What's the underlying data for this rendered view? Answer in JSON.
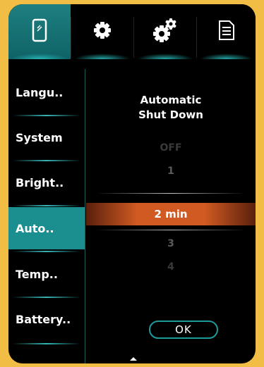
{
  "tabs": [
    {
      "icon": "phone-device-icon",
      "active": true
    },
    {
      "icon": "gear-icon",
      "active": false
    },
    {
      "icon": "gears-icon",
      "active": false
    },
    {
      "icon": "document-icon",
      "active": false
    }
  ],
  "menu": {
    "items": [
      {
        "label": "Langu.."
      },
      {
        "label": "System"
      },
      {
        "label": "Bright.."
      },
      {
        "label": "Auto.."
      },
      {
        "label": "Temp.."
      },
      {
        "label": "Battery.."
      }
    ],
    "active_index": 3
  },
  "panel": {
    "title_line1": "Automatic",
    "title_line2": "Shut Down",
    "options_above": [
      "OFF",
      "1"
    ],
    "selected_value": "2  min",
    "options_below": [
      "3",
      "4"
    ],
    "ok_label": "OK"
  },
  "colors": {
    "background": "#f2bd45",
    "accent_teal": "#1b8e8f",
    "selection_orange": "#d05a22"
  }
}
